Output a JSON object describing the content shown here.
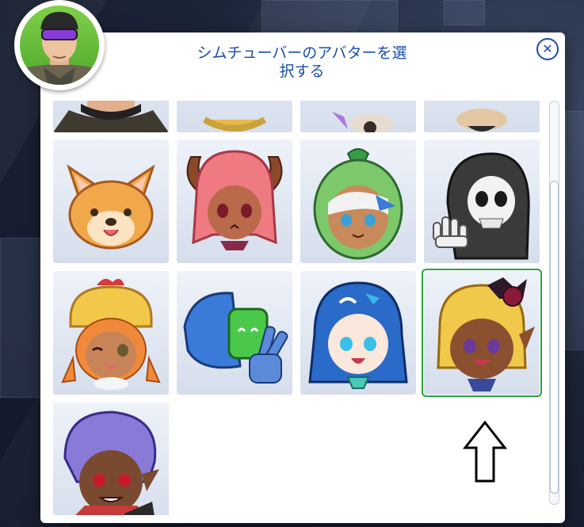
{
  "dialog": {
    "title_line1": "シムチューバーのアバターを選",
    "title_line2": "択する",
    "close_glyph": "✕"
  },
  "profile_avatar": {
    "icon": "profile-avatar-icon"
  },
  "avatars": [
    {
      "id": "partial-1",
      "selected": false
    },
    {
      "id": "partial-2",
      "selected": false
    },
    {
      "id": "partial-3",
      "selected": false
    },
    {
      "id": "partial-4",
      "selected": false
    },
    {
      "id": "corgi",
      "selected": false
    },
    {
      "id": "demon-girl",
      "selected": false
    },
    {
      "id": "green-hood",
      "selected": false
    },
    {
      "id": "reaper",
      "selected": false
    },
    {
      "id": "chicken-hat",
      "selected": false
    },
    {
      "id": "robot-peace",
      "selected": false
    },
    {
      "id": "blue-hair-fish",
      "selected": false
    },
    {
      "id": "blonde-bat",
      "selected": true
    },
    {
      "id": "purple-hair-vampire",
      "selected": false
    }
  ],
  "colors": {
    "title": "#1a4fa6",
    "selected_border": "#2ea23e"
  }
}
